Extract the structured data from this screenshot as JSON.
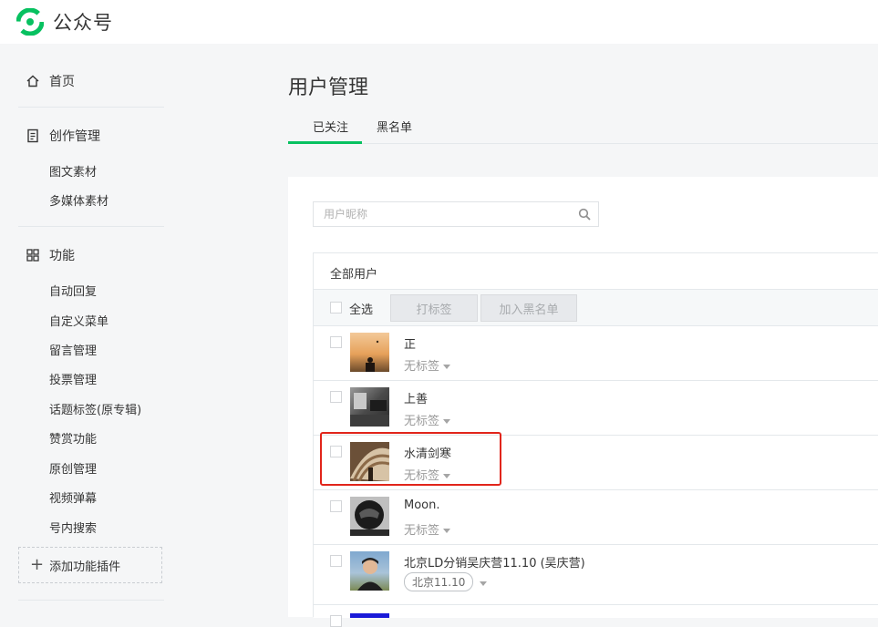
{
  "header": {
    "brand": "公众号"
  },
  "sidebar": {
    "home": "首页",
    "creation": {
      "label": "创作管理",
      "items": [
        "图文素材",
        "多媒体素材"
      ]
    },
    "features": {
      "label": "功能",
      "items": [
        "自动回复",
        "自定义菜单",
        "留言管理",
        "投票管理",
        "话题标签(原专辑)",
        "赞赏功能",
        "原创管理",
        "视频弹幕",
        "号内搜索"
      ]
    },
    "add_plugin": "添加功能插件"
  },
  "main": {
    "title": "用户管理",
    "tabs": [
      "已关注",
      "黑名单"
    ],
    "search_placeholder": "用户昵称",
    "table_title": "全部用户",
    "select_all": "全选",
    "btn_tag": "打标签",
    "btn_blacklist": "加入黑名单",
    "users": [
      {
        "name": "正",
        "tag": "无标签"
      },
      {
        "name": "上善",
        "tag": "无标签"
      },
      {
        "name": "水清剑寒",
        "tag": "无标签"
      },
      {
        "name": "Moon.",
        "tag": "无标签"
      },
      {
        "name": "北京LD分销吴庆营11.10 (吴庆营)",
        "tag": "北京11.10"
      }
    ]
  },
  "colors": {
    "accent": "#07c160",
    "highlight": "#e1251b"
  }
}
